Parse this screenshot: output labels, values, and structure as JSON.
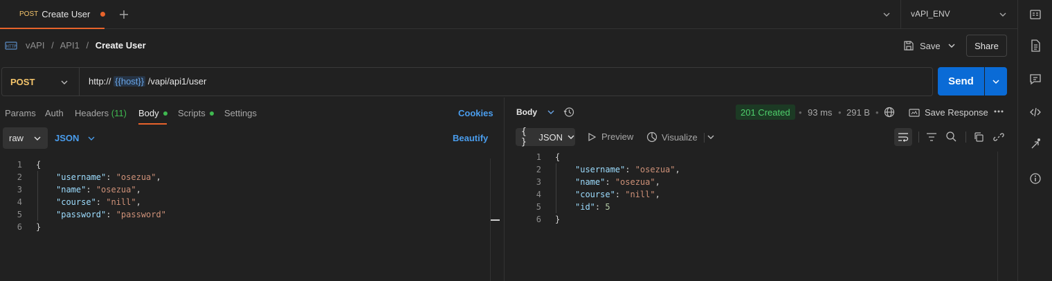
{
  "tab": {
    "method": "POST",
    "title": "Create User"
  },
  "environment": {
    "name": "vAPI_ENV"
  },
  "breadcrumb": {
    "root": "vAPI",
    "folder": "API1",
    "current": "Create User",
    "sep": "/"
  },
  "toolbar": {
    "save_label": "Save",
    "share_label": "Share"
  },
  "request": {
    "method": "POST",
    "url_prefix": "http://",
    "url_var": "{{host}}",
    "url_suffix": "/vapi/api1/user",
    "send_label": "Send"
  },
  "request_tabs": {
    "params": "Params",
    "auth": "Auth",
    "headers": "Headers",
    "headers_count": "(11)",
    "body": "Body",
    "scripts": "Scripts",
    "settings": "Settings",
    "cookies": "Cookies"
  },
  "body_options": {
    "mode": "raw",
    "language": "JSON",
    "beautify": "Beautify"
  },
  "request_body": [
    {
      "n": "1",
      "indent": 0,
      "open": "{"
    },
    {
      "n": "2",
      "indent": 1,
      "key": "\"username\"",
      "val": "\"osezua\"",
      "type": "s",
      "comma": ","
    },
    {
      "n": "3",
      "indent": 1,
      "key": "\"name\"",
      "val": "\"osezua\"",
      "type": "s",
      "comma": ","
    },
    {
      "n": "4",
      "indent": 1,
      "key": "\"course\"",
      "val": "\"nill\"",
      "type": "s",
      "comma": ","
    },
    {
      "n": "5",
      "indent": 1,
      "key": "\"password\"",
      "val": "\"password\"",
      "type": "s",
      "comma": ""
    },
    {
      "n": "6",
      "indent": 0,
      "open": "}"
    }
  ],
  "response": {
    "body_label": "Body",
    "status": "201 Created",
    "time": "93 ms",
    "size": "291 B",
    "save_response": "Save Response",
    "format": "JSON",
    "preview": "Preview",
    "visualize": "Visualize"
  },
  "response_body": [
    {
      "n": "1",
      "indent": 0,
      "open": "{"
    },
    {
      "n": "2",
      "indent": 1,
      "key": "\"username\"",
      "val": "\"osezua\"",
      "type": "s",
      "comma": ","
    },
    {
      "n": "3",
      "indent": 1,
      "key": "\"name\"",
      "val": "\"osezua\"",
      "type": "s",
      "comma": ","
    },
    {
      "n": "4",
      "indent": 1,
      "key": "\"course\"",
      "val": "\"nill\"",
      "type": "s",
      "comma": ","
    },
    {
      "n": "5",
      "indent": 1,
      "key": "\"id\"",
      "val": "5",
      "type": "n",
      "comma": ""
    },
    {
      "n": "6",
      "indent": 0,
      "open": "}"
    }
  ],
  "colors": {
    "accent": "#e8632b",
    "primary": "#0a6bd6",
    "link": "#4a9ded",
    "success": "#4fcf6c",
    "method": "#f5c56b"
  }
}
